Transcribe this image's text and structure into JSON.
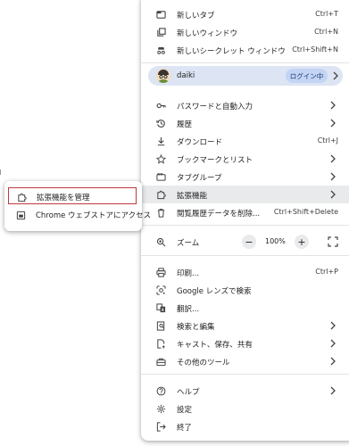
{
  "colors": {
    "accent_border": "#c0393d",
    "profile_bg": "#dde4f3",
    "login_pill_bg": "#c3d4f4",
    "highlight_bg": "#e9eaec"
  },
  "menu": {
    "new_tab": {
      "label": "新しいタブ",
      "shortcut": "Ctrl+T",
      "icon": "new-tab-icon"
    },
    "new_window": {
      "label": "新しいウィンドウ",
      "shortcut": "Ctrl+N",
      "icon": "new-window-icon"
    },
    "incognito": {
      "label": "新しいシークレット ウィンドウ",
      "shortcut": "Ctrl+Shift+N",
      "icon": "incognito-icon"
    },
    "profile": {
      "name": "daiki",
      "login": "ログイン中"
    },
    "passwords": {
      "label": "パスワードと自動入力",
      "icon": "key-icon"
    },
    "history": {
      "label": "履歴",
      "icon": "history-icon"
    },
    "downloads": {
      "label": "ダウンロード",
      "shortcut": "Ctrl+J",
      "icon": "download-icon"
    },
    "bookmarks": {
      "label": "ブックマークとリスト",
      "icon": "star-icon"
    },
    "tab_groups": {
      "label": "タブグループ",
      "icon": "tab-groups-icon"
    },
    "extensions": {
      "label": "拡張機能",
      "icon": "puzzle-icon"
    },
    "clear_data": {
      "label": "閲覧履歴データを削除...",
      "shortcut": "Ctrl+Shift+Delete",
      "icon": "trash-icon"
    },
    "zoom": {
      "label": "ズーム",
      "value": "100%",
      "minus": "−",
      "plus": "+"
    },
    "print": {
      "label": "印刷...",
      "shortcut": "Ctrl+P",
      "icon": "printer-icon"
    },
    "lens": {
      "label": "Google レンズで検索",
      "icon": "lens-icon"
    },
    "translate": {
      "label": "翻訳...",
      "icon": "translate-icon"
    },
    "find_edit": {
      "label": "検索と編集",
      "icon": "find-edit-icon"
    },
    "cast_save": {
      "label": "キャスト、保存、共有",
      "icon": "cast-save-icon"
    },
    "more_tools": {
      "label": "その他のツール",
      "icon": "toolbox-icon"
    },
    "help": {
      "label": "ヘルプ",
      "icon": "help-icon"
    },
    "settings": {
      "label": "設定",
      "icon": "gear-icon"
    },
    "exit": {
      "label": "終了",
      "icon": "exit-icon"
    }
  },
  "submenu": {
    "manage": {
      "label": "拡張機能を管理",
      "icon": "puzzle-icon"
    },
    "webstore": {
      "label": "Chrome ウェブストアにアクセス",
      "icon": "webstore-icon"
    }
  }
}
